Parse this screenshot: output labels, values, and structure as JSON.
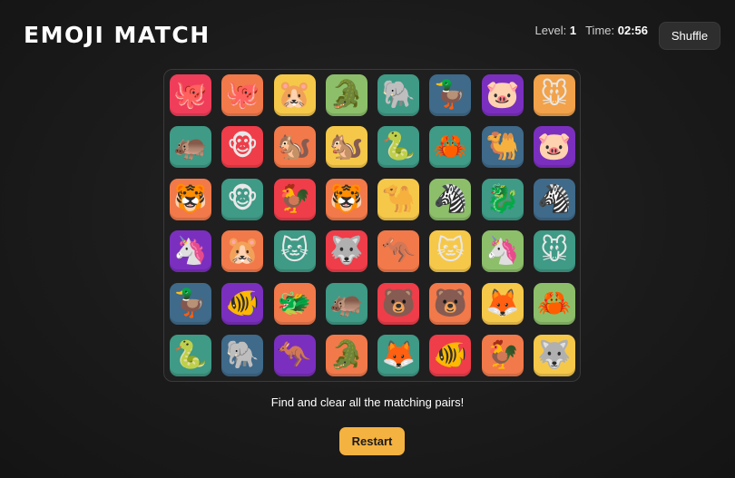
{
  "title": "EMOJI MATCH",
  "hud": {
    "level_label": "Level:",
    "level_value": "1",
    "time_label": "Time:",
    "time_value": "02:56"
  },
  "buttons": {
    "shuffle": "Shuffle",
    "restart": "Restart"
  },
  "message": "Find and clear all the matching pairs!",
  "board": {
    "rows": 6,
    "columns": 8,
    "tiles": [
      {
        "emoji": "🐙",
        "name": "octopus",
        "bg": "#ef3d5a"
      },
      {
        "emoji": "🐙",
        "name": "octopus",
        "bg": "#f2794a"
      },
      {
        "emoji": "🐹",
        "name": "hamster",
        "bg": "#f6c84a"
      },
      {
        "emoji": "🐊",
        "name": "crocodile",
        "bg": "#8dbf6a"
      },
      {
        "emoji": "🐘",
        "name": "elephant",
        "bg": "#3f9a86"
      },
      {
        "emoji": "🦆",
        "name": "duck",
        "bg": "#3f6a8a"
      },
      {
        "emoji": "🐷",
        "name": "pig",
        "bg": "#7b2fbf"
      },
      {
        "emoji": "🐭",
        "name": "mouse",
        "bg": "#f2a24a"
      },
      {
        "emoji": "🦛",
        "name": "hippo",
        "bg": "#3f9a86"
      },
      {
        "emoji": "🐵",
        "name": "monkey",
        "bg": "#ef3d4a"
      },
      {
        "emoji": "🐿️",
        "name": "chipmunk",
        "bg": "#f2794a"
      },
      {
        "emoji": "🐿️",
        "name": "chipmunk",
        "bg": "#f6c84a"
      },
      {
        "emoji": "🐍",
        "name": "snake",
        "bg": "#3f9a86"
      },
      {
        "emoji": "🦀",
        "name": "crab",
        "bg": "#3f9a86"
      },
      {
        "emoji": "🐫",
        "name": "camel",
        "bg": "#3f6a8a"
      },
      {
        "emoji": "🐷",
        "name": "pig",
        "bg": "#7b2fbf"
      },
      {
        "emoji": "🐯",
        "name": "tiger",
        "bg": "#f2794a"
      },
      {
        "emoji": "🐵",
        "name": "monkey",
        "bg": "#3f9a86"
      },
      {
        "emoji": "🐓",
        "name": "rooster",
        "bg": "#ef3d4a"
      },
      {
        "emoji": "🐯",
        "name": "tiger",
        "bg": "#f2794a"
      },
      {
        "emoji": "🐪",
        "name": "camel",
        "bg": "#f6c84a"
      },
      {
        "emoji": "🦓",
        "name": "zebra",
        "bg": "#8dbf6a"
      },
      {
        "emoji": "🐉",
        "name": "dragon",
        "bg": "#3f9a86"
      },
      {
        "emoji": "🦓",
        "name": "zebra",
        "bg": "#3f6a8a"
      },
      {
        "emoji": "🦄",
        "name": "unicorn",
        "bg": "#7b2fbf"
      },
      {
        "emoji": "🐹",
        "name": "hamster",
        "bg": "#f2794a"
      },
      {
        "emoji": "🐱",
        "name": "cat",
        "bg": "#3f9a86"
      },
      {
        "emoji": "🐺",
        "name": "wolf",
        "bg": "#ef3d4a"
      },
      {
        "emoji": "🦘",
        "name": "kangaroo",
        "bg": "#f2794a"
      },
      {
        "emoji": "🐱",
        "name": "cat",
        "bg": "#f6c84a"
      },
      {
        "emoji": "🦄",
        "name": "unicorn",
        "bg": "#8dbf6a"
      },
      {
        "emoji": "🐭",
        "name": "mouse",
        "bg": "#3f9a86"
      },
      {
        "emoji": "🦆",
        "name": "duck",
        "bg": "#3f6a8a"
      },
      {
        "emoji": "🐠",
        "name": "fish",
        "bg": "#7b2fbf"
      },
      {
        "emoji": "🐲",
        "name": "dragon",
        "bg": "#f2794a"
      },
      {
        "emoji": "🦛",
        "name": "hippo",
        "bg": "#3f9a86"
      },
      {
        "emoji": "🐻",
        "name": "bear",
        "bg": "#ef3d4a"
      },
      {
        "emoji": "🐻",
        "name": "bear",
        "bg": "#f2794a"
      },
      {
        "emoji": "🦊",
        "name": "fox",
        "bg": "#f6c84a"
      },
      {
        "emoji": "🦀",
        "name": "crab",
        "bg": "#8dbf6a"
      },
      {
        "emoji": "🐍",
        "name": "snake",
        "bg": "#3f9a86"
      },
      {
        "emoji": "🐘",
        "name": "elephant",
        "bg": "#3f6a8a"
      },
      {
        "emoji": "🦘",
        "name": "kangaroo",
        "bg": "#7b2fbf"
      },
      {
        "emoji": "🐊",
        "name": "crocodile",
        "bg": "#f2794a"
      },
      {
        "emoji": "🦊",
        "name": "fox",
        "bg": "#3f9a86"
      },
      {
        "emoji": "🐠",
        "name": "fish",
        "bg": "#ef3d4a"
      },
      {
        "emoji": "🐓",
        "name": "rooster",
        "bg": "#f2794a"
      },
      {
        "emoji": "🐺",
        "name": "wolf",
        "bg": "#f6c84a"
      }
    ]
  }
}
